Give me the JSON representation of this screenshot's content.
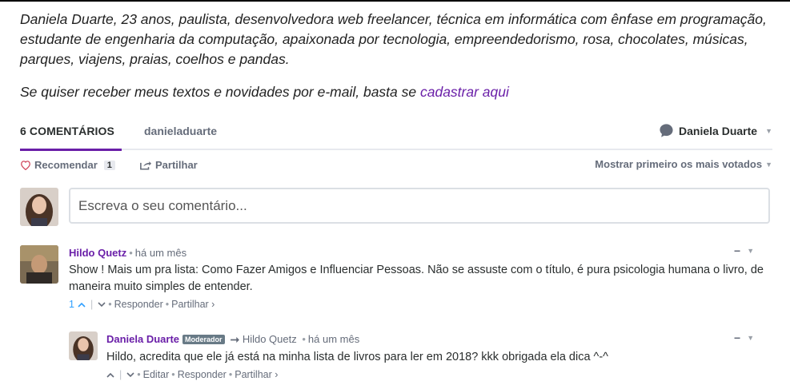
{
  "profile": {
    "bio": "Daniela Duarte, 23 anos, paulista, desenvolvedora web freelancer, técnica em informática com ênfase em programação, estudante de engenharia da computação, apaixonada por tecnologia, empreendedorismo, rosa, chocolates, músicas, parques, viajens, praias, coelhos e pandas.",
    "signup_text": "Se quiser receber meus textos e novidades por e-mail, basta se ",
    "signup_link": "cadastrar aqui"
  },
  "nav": {
    "comments_tab": "6 COMENTÁRIOS",
    "community_tab": "danieladuarte",
    "user_name": "Daniela Duarte"
  },
  "actions": {
    "recommend_label": "Recomendar",
    "recommend_count": "1",
    "share_label": "Partilhar",
    "sort_label": "Mostrar primeiro os mais votados"
  },
  "composer": {
    "placeholder": "Escreva o seu comentário..."
  },
  "comments": [
    {
      "author": "Hildo Quetz",
      "time": "há um mês",
      "text": "Show ! Mais um pra lista: Como Fazer Amigos e Influenciar Pessoas. Não se assuste com o título, é pura psicologia humana o livro, de maneira muito simples de entender.",
      "votes": "1",
      "reply": "Responder",
      "share": "Partilhar ›"
    },
    {
      "author": "Daniela Duarte",
      "badge": "Moderador",
      "reply_to": "Hildo Quetz",
      "time": "há um mês",
      "text": "Hildo, acredita que ele já está na minha lista de livros para ler em 2018? kkk obrigada ela dica ^-^",
      "edit": "Editar",
      "reply": "Responder",
      "share": "Partilhar ›"
    }
  ],
  "colors": {
    "accent": "#6a1fa8",
    "vote": "#2e9fff",
    "muted": "#656c7a"
  },
  "icons": [
    "heart-icon",
    "share-icon",
    "speech-bubble-icon",
    "chevron-down-icon",
    "upvote-icon",
    "downvote-icon",
    "reply-arrow-icon",
    "collapse-icon"
  ]
}
